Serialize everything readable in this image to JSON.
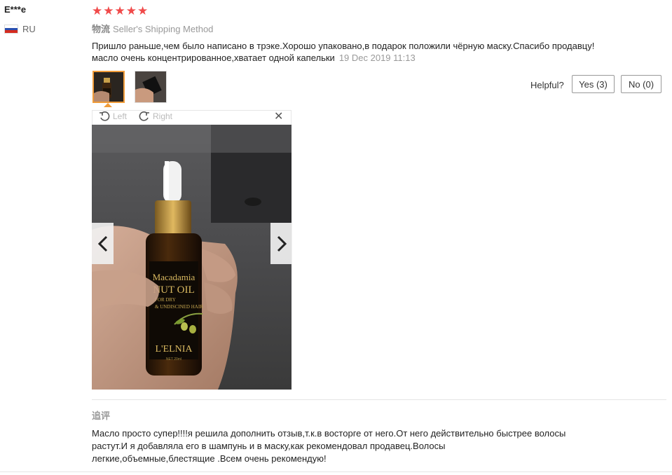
{
  "reviewer": {
    "name": "E***e",
    "country": "RU"
  },
  "rating": {
    "stars": "★★★★★",
    "value": 5
  },
  "shipping": {
    "label": "物流",
    "value": "Seller's Shipping Method"
  },
  "review": {
    "text": "Пришло раньше,чем было написано в трэке.Хорошо упаковано,в подарок положили чёрную маску.Спасибо продавцу!масло очень концентрированное,хватает одной капельки",
    "date": "19 Dec 2019 11:13"
  },
  "helpful": {
    "label": "Helpful?",
    "yes": "Yes (3)",
    "no": "No (0)"
  },
  "viewer": {
    "rotate_left": "Left",
    "rotate_right": "Right",
    "close": "✕"
  },
  "product_photo": {
    "label_line1": "Macadamia",
    "label_line2": "NUT OIL",
    "label_line3": "FOR DRY",
    "label_line4": "& UNDISCINED HAIR",
    "brand": "L'ELNIA",
    "volume": "NET 20ml"
  },
  "followup": {
    "label": "追评",
    "text": "Масло просто супер!!!!я решила дополнить отзыв,т.к.в восторге от него.От него действительно быстрее волосы растут.И я добавляла его в шампунь и в маску,как рекомендовал продавец.Волосы легкие,объемные,блестящие .Всем очень рекомендую!"
  },
  "colors": {
    "star": "#f04a4a",
    "thumb_active": "#f09c3a",
    "muted": "#999999"
  }
}
